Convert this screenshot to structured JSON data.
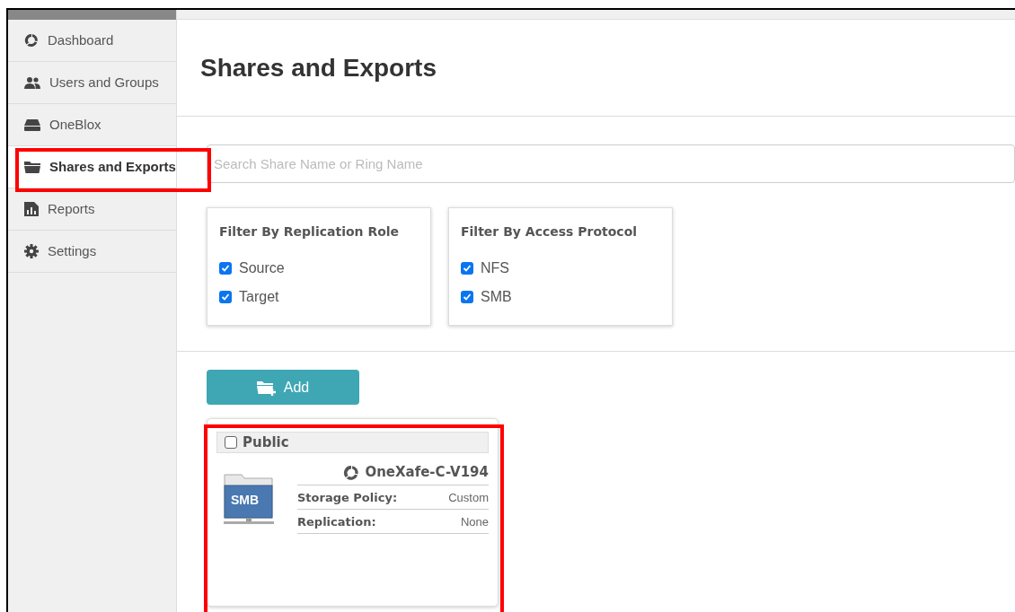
{
  "sidebar": {
    "items": [
      {
        "label": "Dashboard",
        "kind": "ring",
        "selected": false,
        "highlighted": false
      },
      {
        "label": "Users and Groups",
        "kind": "users",
        "selected": false,
        "highlighted": false
      },
      {
        "label": "OneBlox",
        "kind": "drive",
        "selected": false,
        "highlighted": false
      },
      {
        "label": "Shares and Exports",
        "kind": "folder",
        "selected": true,
        "highlighted": true
      },
      {
        "label": "Reports",
        "kind": "report",
        "selected": false,
        "highlighted": false
      },
      {
        "label": "Settings",
        "kind": "gear",
        "selected": false,
        "highlighted": false
      }
    ]
  },
  "page": {
    "title": "Shares and Exports"
  },
  "search": {
    "placeholder": "Search Share Name or Ring Name"
  },
  "filters": [
    {
      "title": "Filter By Replication Role",
      "options": [
        {
          "label": "Source",
          "checked": true
        },
        {
          "label": "Target",
          "checked": true
        }
      ]
    },
    {
      "title": "Filter By Access Protocol",
      "options": [
        {
          "label": "NFS",
          "checked": true
        },
        {
          "label": "SMB",
          "checked": true
        }
      ]
    }
  ],
  "add_button": {
    "label": "Add"
  },
  "shares": [
    {
      "name": "Public",
      "checked": false,
      "protocol": "SMB",
      "ring": "OneXafe-C-V194",
      "highlighted": true,
      "fields": [
        {
          "label": "Storage Policy:",
          "value": "Custom"
        },
        {
          "label": "Replication:",
          "value": "None"
        }
      ]
    }
  ]
}
